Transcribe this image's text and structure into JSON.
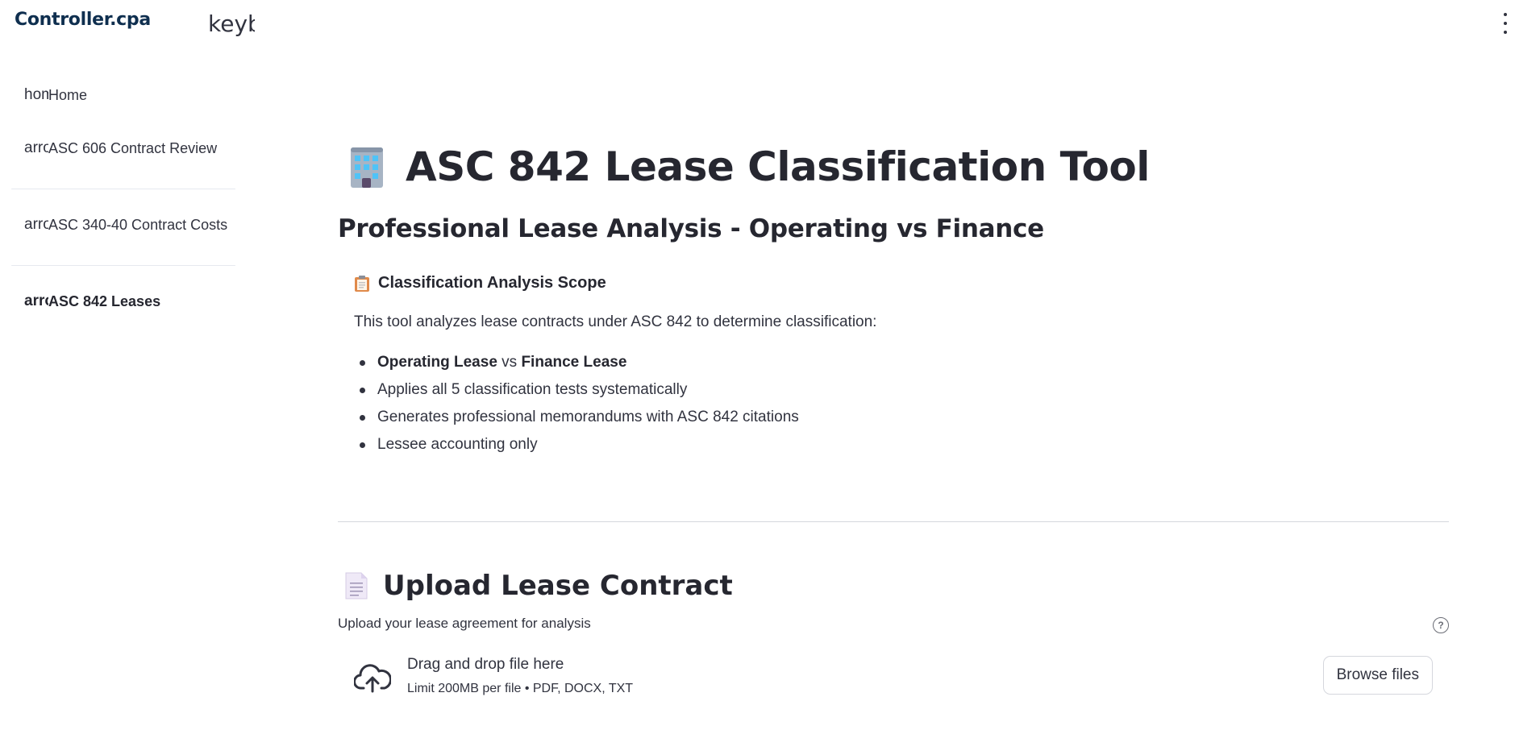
{
  "header": {
    "logo": "Controller.cpa",
    "collapse_icon_text": "keyboard_double_arrow_left"
  },
  "sidebar": {
    "items": [
      {
        "icon_text": "home",
        "label": "Home",
        "active": false
      },
      {
        "icon_text": "arrow_forward",
        "label": "ASC 606 Contract Review",
        "active": false
      },
      {
        "icon_text": "arrow_forward",
        "label": "ASC 340-40 Contract Costs",
        "active": false
      },
      {
        "icon_text": "arrow_forward",
        "label": "ASC 842 Leases",
        "active": true
      }
    ]
  },
  "main": {
    "title": "ASC 842 Lease Classification Tool",
    "subtitle": "Professional Lease Analysis - Operating vs Finance",
    "scope": {
      "heading": "Classification Analysis Scope",
      "intro": "This tool analyzes lease contracts under ASC 842 to determine classification:",
      "bullet1": {
        "part1": "Operating Lease",
        "part2": " vs ",
        "part3": "Finance Lease"
      },
      "bullets": [
        "Applies all 5 classification tests systematically",
        "Generates professional memorandums with ASC 842 citations",
        "Lessee accounting only"
      ]
    },
    "upload": {
      "title": "Upload Lease Contract",
      "label": "Upload your lease agreement for analysis",
      "help_icon": "?",
      "drop_title": "Drag and drop file here",
      "drop_limit": "Limit 200MB per file • PDF, DOCX, TXT",
      "browse_label": "Browse files"
    }
  },
  "icons": {
    "title_icon": "office-building-icon",
    "scope_icon": "clipboard-icon",
    "upload_icon": "page-facing-up-icon",
    "drop_icon": "cloud-upload-icon"
  },
  "colors": {
    "logo": "#0f2f4f",
    "text": "#262730",
    "divider": "#d5d7dd"
  }
}
